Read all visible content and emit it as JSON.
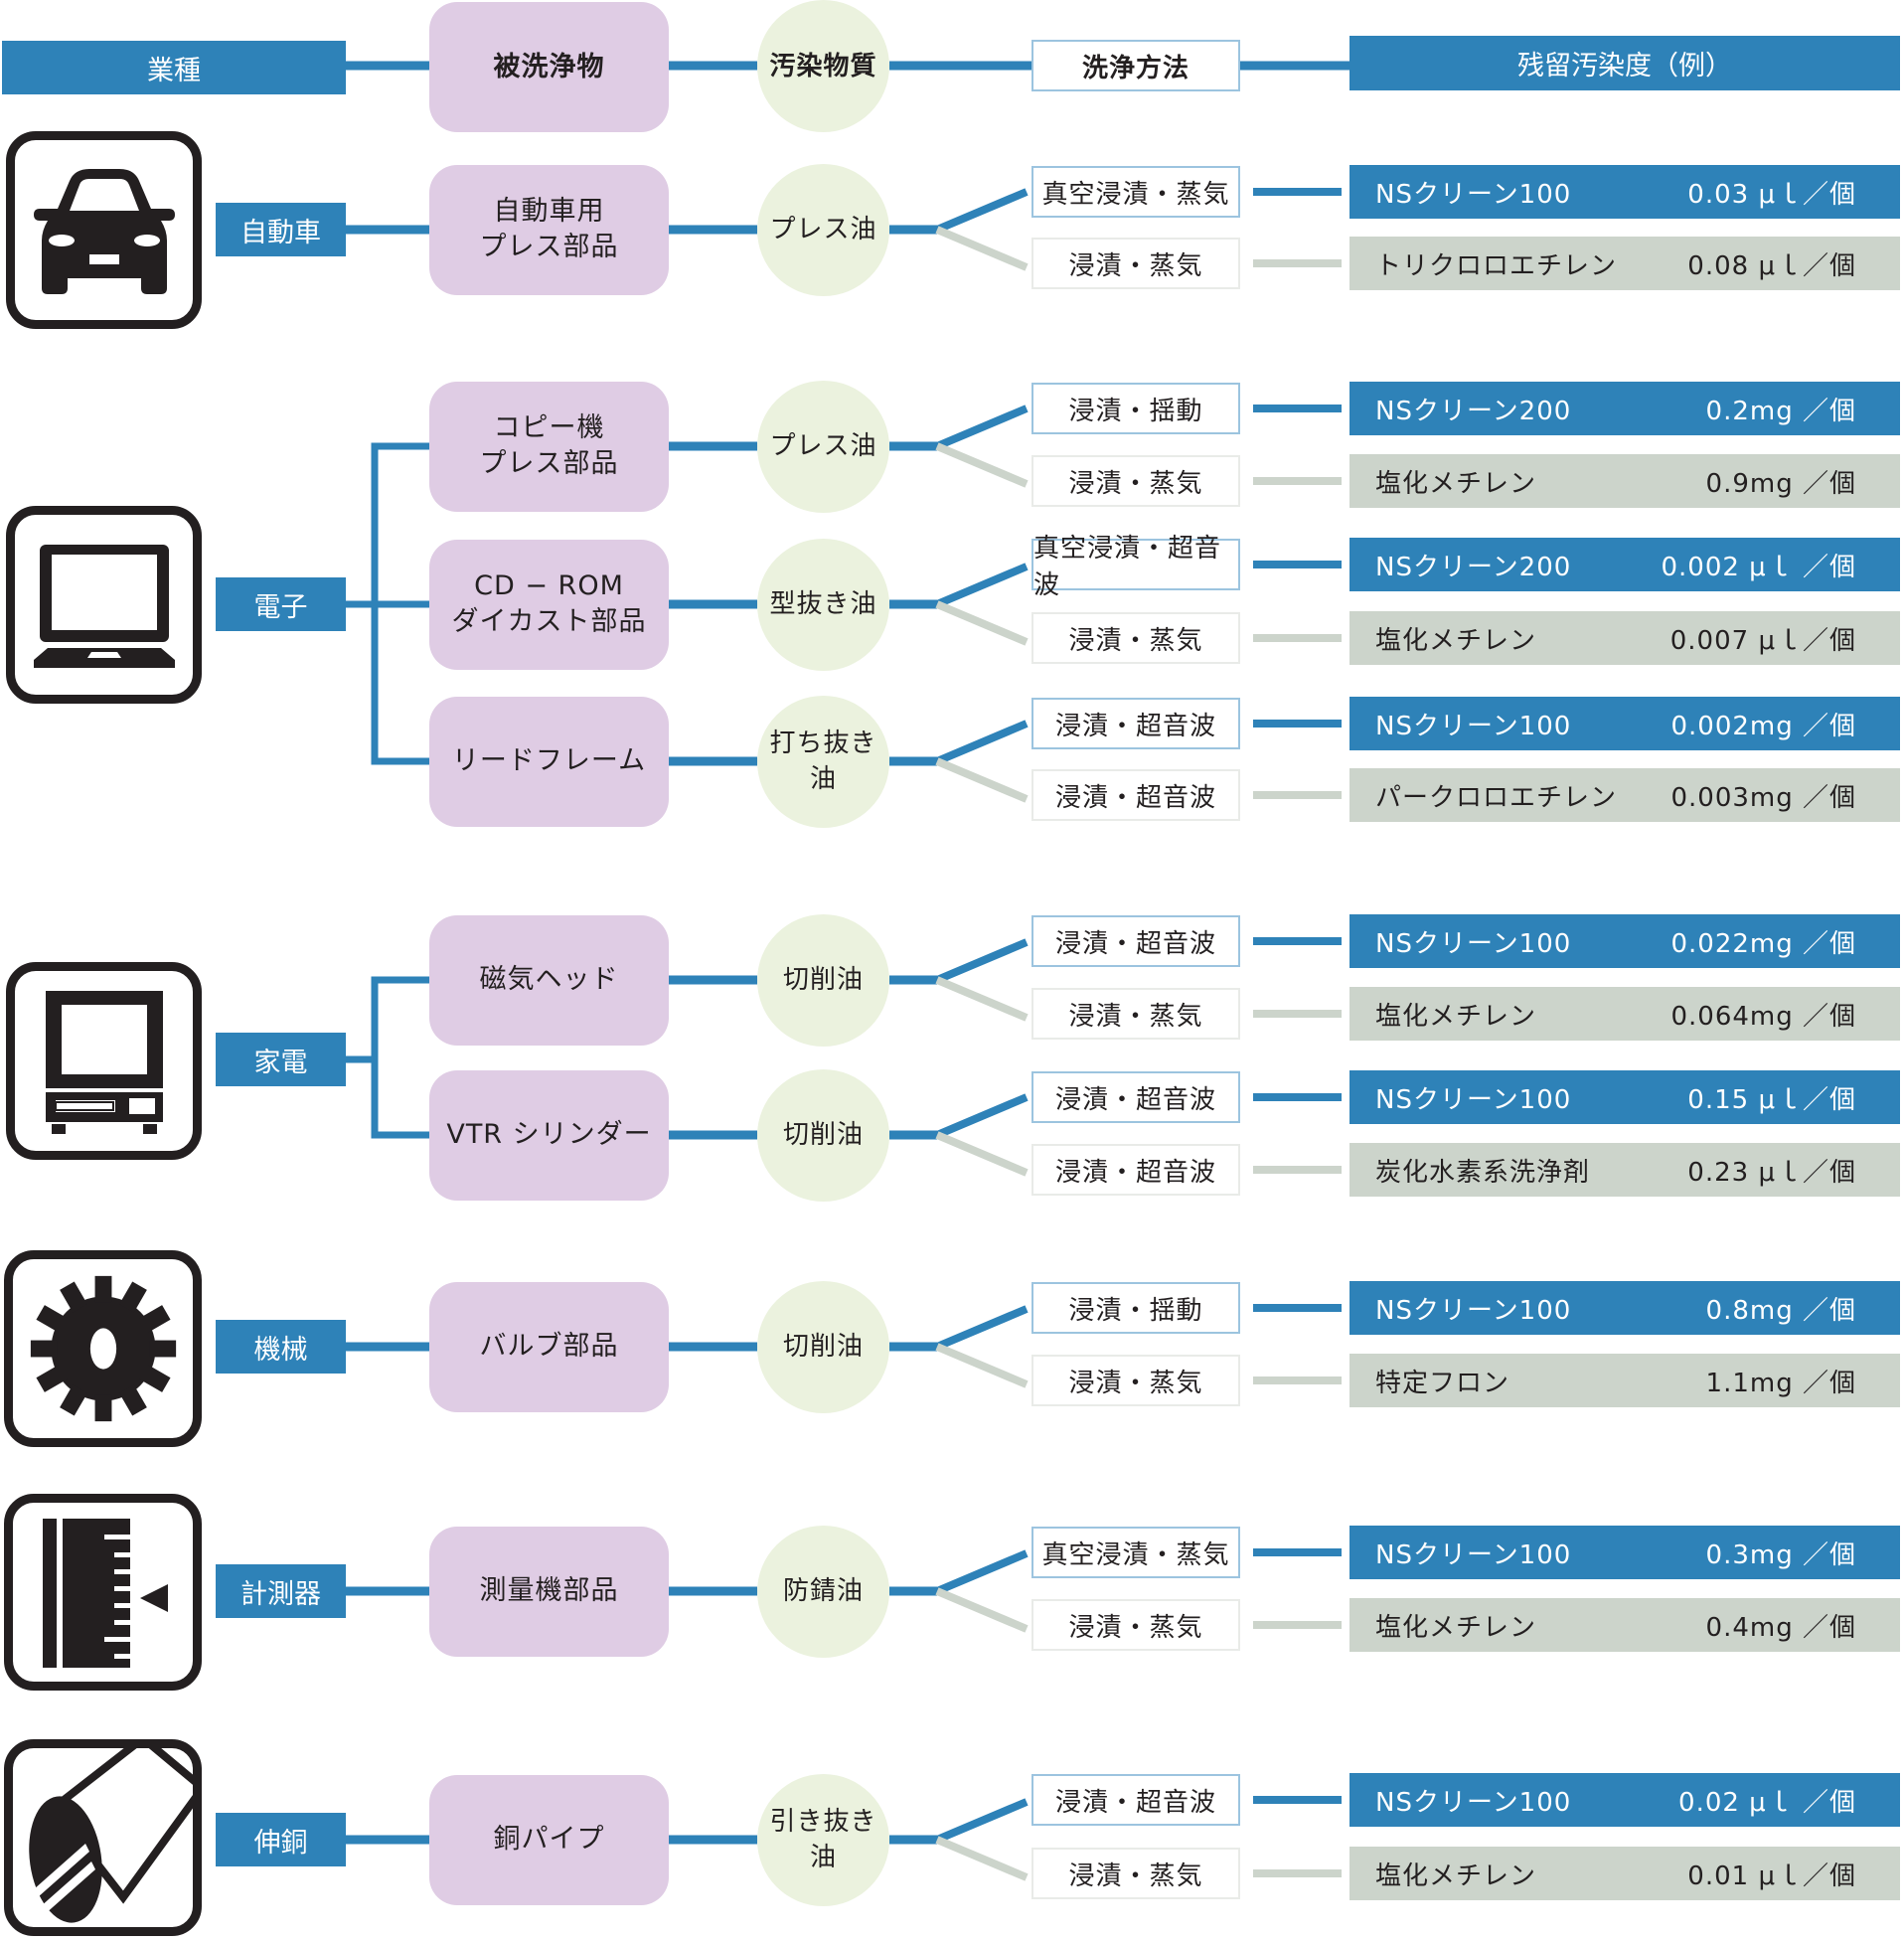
{
  "header": {
    "industry": "業種",
    "object": "被洗浄物",
    "contaminant": "汚染物質",
    "method": "洗浄方法",
    "residual": "残留汚染度（例）"
  },
  "colors": {
    "accent_blue": "#2e82b8",
    "secondary_gray": "#ccd4cb",
    "object_lavender": "#dfcce4",
    "contaminant_green": "#ebf2de"
  },
  "industries": [
    {
      "label": "自動車",
      "icon": "car-icon",
      "objects": [
        {
          "name": "自動車用\nプレス部品",
          "contaminant": "プレス油",
          "primary": {
            "method": "真空浸漬・蒸気",
            "agent": "NSクリーン100",
            "residual": "0.03 μｌ／個"
          },
          "secondary": {
            "method": "浸漬・蒸気",
            "agent": "トリクロロエチレン",
            "residual": "0.08 μｌ／個"
          }
        }
      ]
    },
    {
      "label": "電子",
      "icon": "laptop-icon",
      "objects": [
        {
          "name": "コピー機\nプレス部品",
          "contaminant": "プレス油",
          "primary": {
            "method": "浸漬・揺動",
            "agent": "NSクリーン200",
            "residual": "0.2mg ／個"
          },
          "secondary": {
            "method": "浸漬・蒸気",
            "agent": "塩化メチレン",
            "residual": "0.9mg ／個"
          }
        },
        {
          "name": "CD − ROM\nダイカスト部品",
          "contaminant": "型抜き油",
          "primary": {
            "method": "真空浸漬・超音波",
            "agent": "NSクリーン200",
            "residual": "0.002 μｌ ／個"
          },
          "secondary": {
            "method": "浸漬・蒸気",
            "agent": "塩化メチレン",
            "residual": "0.007 μｌ／個"
          }
        },
        {
          "name": "リードフレーム",
          "contaminant": "打ち抜き\n油",
          "primary": {
            "method": "浸漬・超音波",
            "agent": "NSクリーン100",
            "residual": "0.002mg ／個"
          },
          "secondary": {
            "method": "浸漬・超音波",
            "agent": "パークロロエチレン",
            "residual": "0.003mg ／個"
          }
        }
      ]
    },
    {
      "label": "家電",
      "icon": "television-icon",
      "objects": [
        {
          "name": "磁気ヘッド",
          "contaminant": "切削油",
          "primary": {
            "method": "浸漬・超音波",
            "agent": "NSクリーン100",
            "residual": "0.022mg ／個"
          },
          "secondary": {
            "method": "浸漬・蒸気",
            "agent": "塩化メチレン",
            "residual": "0.064mg ／個"
          }
        },
        {
          "name": "VTR シリンダー",
          "contaminant": "切削油",
          "primary": {
            "method": "浸漬・超音波",
            "agent": "NSクリーン100",
            "residual": "0.15 μｌ／個"
          },
          "secondary": {
            "method": "浸漬・超音波",
            "agent": "炭化水素系洗浄剤",
            "residual": "0.23 μｌ／個"
          }
        }
      ]
    },
    {
      "label": "機械",
      "icon": "gear-icon",
      "objects": [
        {
          "name": "バルブ部品",
          "contaminant": "切削油",
          "primary": {
            "method": "浸漬・揺動",
            "agent": "NSクリーン100",
            "residual": "0.8mg ／個"
          },
          "secondary": {
            "method": "浸漬・蒸気",
            "agent": "特定フロン",
            "residual": "1.1mg ／個"
          }
        }
      ]
    },
    {
      "label": "計測器",
      "icon": "ruler-gauge-icon",
      "objects": [
        {
          "name": "測量機部品",
          "contaminant": "防錆油",
          "primary": {
            "method": "真空浸漬・蒸気",
            "agent": "NSクリーン100",
            "residual": "0.3mg ／個"
          },
          "secondary": {
            "method": "浸漬・蒸気",
            "agent": "塩化メチレン",
            "residual": "0.4mg ／個"
          }
        }
      ]
    },
    {
      "label": "伸銅",
      "icon": "copper-pipe-icon",
      "objects": [
        {
          "name": "銅パイプ",
          "contaminant": "引き抜き\n油",
          "primary": {
            "method": "浸漬・超音波",
            "agent": "NSクリーン100",
            "residual": "0.02 μｌ ／個"
          },
          "secondary": {
            "method": "浸漬・蒸気",
            "agent": "塩化メチレン",
            "residual": "0.01 μｌ／個"
          }
        }
      ]
    }
  ]
}
